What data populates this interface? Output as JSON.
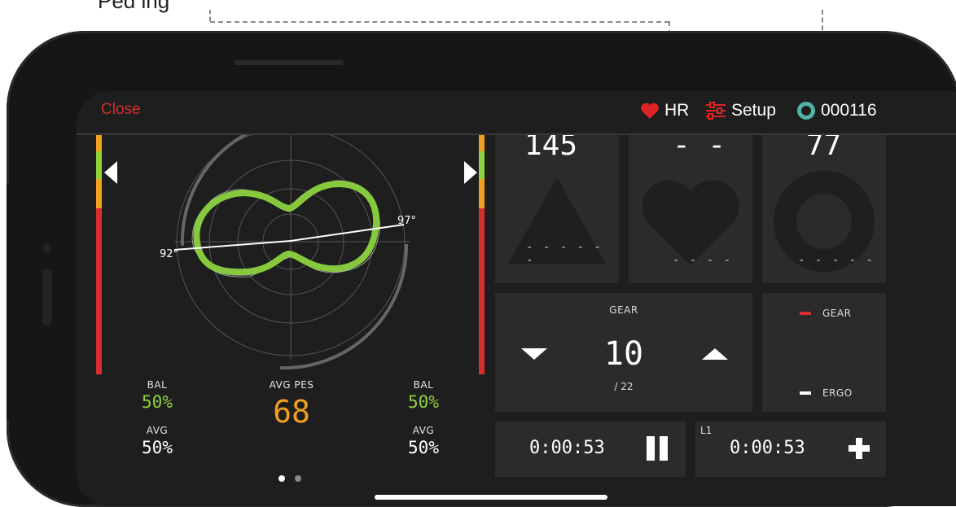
{
  "callout": {
    "text": "Ped  ing"
  },
  "header": {
    "close_label": "Close",
    "hr_label": "HR",
    "setup_label": "Setup",
    "device_id": "000116"
  },
  "left_pane": {
    "angle_left": "92°",
    "angle_right": "97°",
    "left": {
      "bal_label": "BAL",
      "bal_value": "50%",
      "avg_label": "AVG",
      "avg_value": "50%"
    },
    "center": {
      "label": "AVG PES",
      "value": "68"
    },
    "right": {
      "bal_label": "BAL",
      "bal_value": "50%",
      "avg_label": "AVG",
      "avg_value": "50%"
    },
    "page_count": 2,
    "active_page": 1
  },
  "tiles": {
    "power": {
      "value": "145",
      "dashes": "- - - - - -"
    },
    "heart": {
      "value": "- -",
      "dashes": "- - - -"
    },
    "cadence": {
      "value": "77",
      "dashes": "- - - - -"
    }
  },
  "gear": {
    "label": "GEAR",
    "value": "10",
    "total": "/ 22"
  },
  "mode_legend": {
    "gear_label": "GEAR",
    "ergo_label": "ERGO"
  },
  "timers": {
    "elapsed": "0:00:53",
    "lap_label": "L1",
    "lap_time": "0:00:53"
  },
  "colors": {
    "accent_red": "#d42e2e",
    "green": "#8fd23e",
    "orange": "#f0a020",
    "teal": "#4fb3a8",
    "tile_bg": "#2b2b2b",
    "screen_bg": "#1e1e1e"
  },
  "icons": {
    "close": "close-text",
    "hr": "heart-icon",
    "setup": "sliders-icon",
    "device": "ring-icon",
    "pause": "pause-icon",
    "plus": "plus-icon"
  }
}
